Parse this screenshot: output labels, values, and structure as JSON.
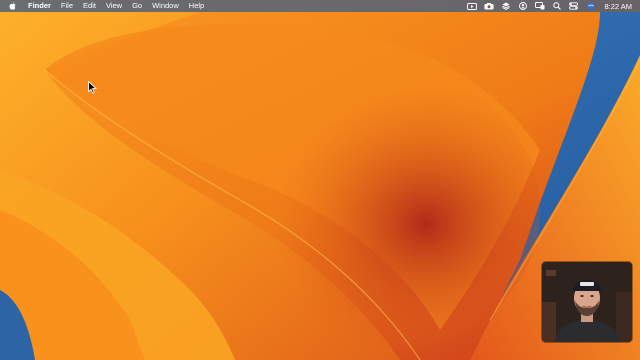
{
  "menubar": {
    "apple_icon": "apple-icon",
    "app_name": "Finder",
    "menus": [
      "File",
      "Edit",
      "View",
      "Go",
      "Window",
      "Help"
    ],
    "status_icons": [
      "screen-record-icon",
      "camera-icon",
      "layers-icon",
      "user-circle-icon",
      "display-icon",
      "search-icon",
      "control-center-icon",
      "siri-icon"
    ],
    "clock": "8:22 AM"
  },
  "desktop": {
    "wallpaper_colors": [
      "#f7a21f",
      "#f07a16",
      "#d8501e",
      "#2e68a8"
    ]
  },
  "webcam_overlay": {
    "icon": "presenter-video-icon"
  }
}
